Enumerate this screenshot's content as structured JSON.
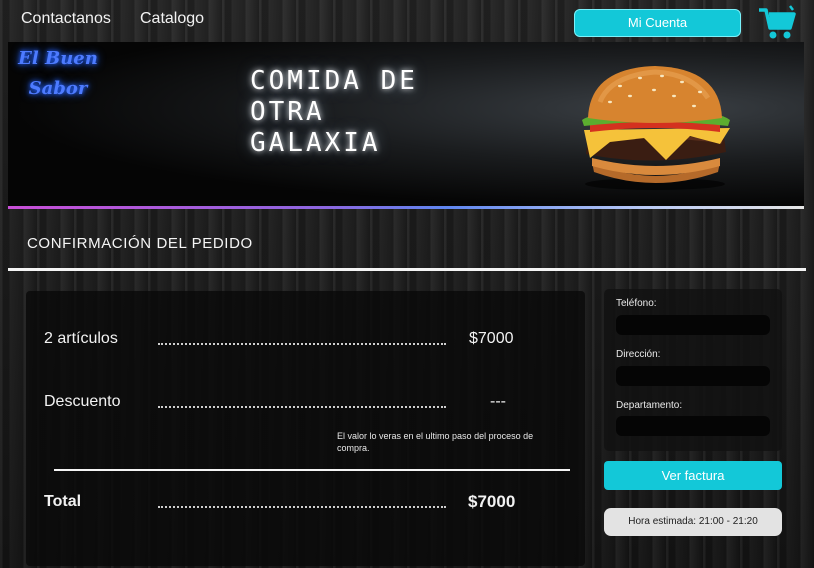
{
  "nav": {
    "contact": "Contactanos",
    "catalog": "Catalogo",
    "account_button": "Mi Cuenta",
    "cart_icon": "shopping-cart-icon"
  },
  "banner": {
    "logo_line1": "El Buen",
    "logo_line2": "Sabor",
    "hero_line1": "Comida de",
    "hero_line2": "otra",
    "hero_line3": "galaxia",
    "image": "burger-image"
  },
  "page": {
    "title": "CONFIRMACIÓN DEL PEDIDO"
  },
  "summary": {
    "items_label": "2 artículos",
    "items_value": "$7000",
    "discount_label": "Descuento",
    "discount_value": "---",
    "discount_note": "El valor lo veras en el ultimo paso del proceso de compra.",
    "total_label": "Total",
    "total_value": "$7000"
  },
  "contact": {
    "phone_label": "Teléfono:",
    "phone_value": "",
    "address_label": "Dirección:",
    "address_value": "",
    "department_label": "Departamento:",
    "department_value": ""
  },
  "actions": {
    "invoice_button": "Ver factura",
    "eta": "Hora estimada: 21:00 - 21:20"
  },
  "colors": {
    "accent": "#13c8d8",
    "logo_neon": "#4d7bff",
    "background": "#1c1c1c"
  }
}
